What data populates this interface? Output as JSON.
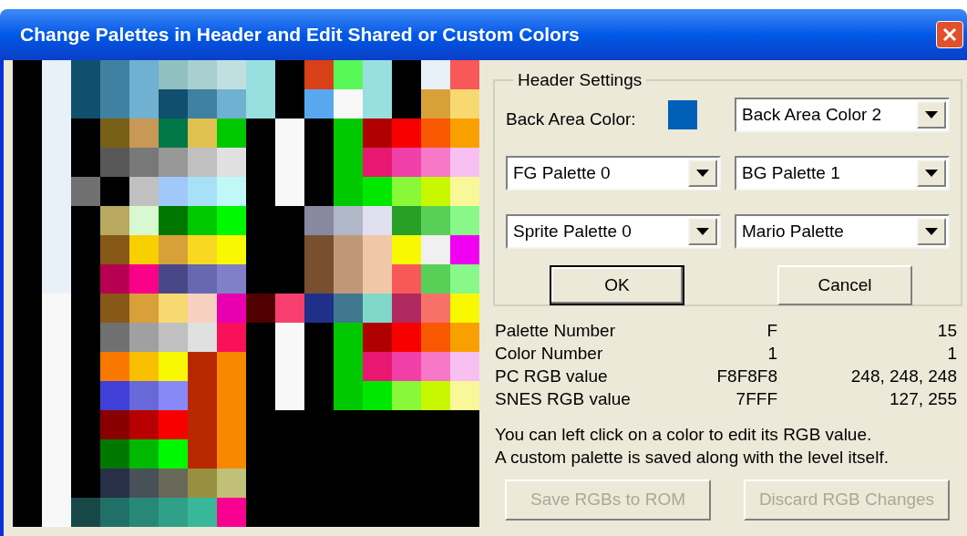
{
  "window": {
    "title": "Change Palettes in Header and Edit Shared or Custom Colors"
  },
  "palette": {
    "rows": [
      [
        null,
        {
          "color": "#e8f0f8"
        },
        {
          "color": "#10506e"
        },
        {
          "color": "#4080a0"
        },
        {
          "color": "#70b0d0"
        },
        {
          "color": "#90c0c0"
        },
        {
          "color": "#a8d0d0"
        },
        {
          "color": "#c0e0e0"
        },
        {
          "color": "#98e0e0"
        },
        null,
        {
          "color": "#d84018"
        },
        {
          "color": "#58f858"
        },
        {
          "color": "#98e0e0"
        },
        null,
        {
          "color": "#e8f0f8"
        },
        {
          "color": "#f85858"
        }
      ],
      [
        null,
        {
          "color": "#e8f0f8"
        },
        {
          "color": "#10506e"
        },
        {
          "color": "#4080a0"
        },
        {
          "color": "#70b0d0"
        },
        {
          "color": "#10506e"
        },
        {
          "color": "#4080a0"
        },
        {
          "color": "#70b0d0"
        },
        {
          "color": "#98e0e0"
        },
        null,
        {
          "color": "#58a8f0"
        },
        {
          "color": "#f8f8f8"
        },
        {
          "color": "#98e0e0"
        },
        null,
        {
          "color": "#d8a038"
        },
        {
          "color": "#f8d870"
        }
      ],
      [
        null,
        {
          "color": "#e8f0f8"
        },
        null,
        {
          "color": "#786018"
        },
        {
          "color": "#c89858"
        },
        {
          "color": "#007848"
        },
        {
          "color": "#e0c050"
        },
        {
          "color": "#00c800"
        },
        null,
        {
          "color": "#f8f8f8"
        },
        null,
        {
          "color": "#00c800"
        },
        {
          "color": "#b00000"
        },
        {
          "color": "#f80000"
        },
        {
          "color": "#f85800"
        },
        {
          "color": "#f8a000"
        }
      ],
      [
        null,
        {
          "color": "#e8f0f8"
        },
        null,
        {
          "color": "#585858"
        },
        {
          "color": "#787878"
        },
        {
          "color": "#989898"
        },
        {
          "color": "#c0c0c0"
        },
        {
          "color": "#e0e0e0"
        },
        null,
        {
          "color": "#f8f8f8"
        },
        null,
        {
          "color": "#00c800"
        },
        {
          "color": "#e81870"
        },
        {
          "color": "#f040a8"
        },
        {
          "color": "#f878c8"
        },
        {
          "color": "#f8c0f0"
        }
      ],
      [
        null,
        {
          "color": "#e8f0f8"
        },
        {
          "color": "#707070"
        },
        null,
        {
          "color": "#c0c0c0"
        },
        {
          "color": "#a0c8f8"
        },
        {
          "color": "#a8e0f8"
        },
        {
          "color": "#c0f8f8"
        },
        null,
        {
          "color": "#f8f8f8"
        },
        null,
        {
          "color": "#00c800"
        },
        {
          "color": "#00e800"
        },
        {
          "color": "#88f838"
        },
        {
          "color": "#c8f800"
        },
        {
          "color": "#f8f898"
        }
      ],
      [
        null,
        {
          "color": "#e8f0f8"
        },
        null,
        {
          "color": "#b8a860"
        },
        {
          "color": "#d8f8d0"
        },
        {
          "color": "#007800"
        },
        {
          "color": "#00c800"
        },
        {
          "color": "#00f800"
        },
        null,
        null,
        {
          "color": "#8888a0"
        },
        {
          "color": "#b0b8c8"
        },
        {
          "color": "#e0e0f0"
        },
        {
          "color": "#28a028"
        },
        {
          "color": "#58d058"
        },
        {
          "color": "#88f888"
        }
      ],
      [
        null,
        {
          "color": "#e8f0f8"
        },
        null,
        {
          "color": "#885818"
        },
        {
          "color": "#f8d000"
        },
        {
          "color": "#d8a038"
        },
        {
          "color": "#f8d820"
        },
        {
          "color": "#f8f800"
        },
        null,
        null,
        {
          "color": "#785030"
        },
        {
          "color": "#c09878"
        },
        {
          "color": "#f0c8a8"
        },
        {
          "color": "#f8f800"
        },
        {
          "color": "#f0f0f0"
        },
        {
          "color": "#f000f0"
        }
      ],
      [
        null,
        {
          "color": "#e8f0f8"
        },
        null,
        {
          "color": "#b80050"
        },
        {
          "color": "#f80088"
        },
        {
          "color": "#484888"
        },
        {
          "color": "#6868b0"
        },
        {
          "color": "#8080c8"
        },
        null,
        null,
        {
          "color": "#785030"
        },
        {
          "color": "#c09878"
        },
        {
          "color": "#f0c8a8"
        },
        {
          "color": "#f85858"
        },
        {
          "color": "#58d058"
        },
        {
          "color": "#88f888"
        }
      ],
      [
        null,
        {
          "color": "#f8f8f8"
        },
        null,
        {
          "color": "#885818"
        },
        {
          "color": "#d8a038"
        },
        {
          "color": "#f8d870"
        },
        {
          "color": "#f8d0c0"
        },
        {
          "color": "#e800b0"
        },
        {
          "color": "#500000"
        },
        {
          "color": "#f84070"
        },
        {
          "color": "#203088"
        },
        {
          "color": "#407890"
        },
        {
          "color": "#80d8c8"
        },
        {
          "color": "#b02860"
        },
        {
          "color": "#f87068"
        },
        {
          "color": "#f8f800"
        }
      ],
      [
        null,
        {
          "color": "#f8f8f8"
        },
        null,
        {
          "color": "#707070"
        },
        {
          "color": "#a0a0a0"
        },
        {
          "color": "#c0c0c0"
        },
        {
          "color": "#e0e0e0"
        },
        {
          "color": "#f81058"
        },
        null,
        {
          "color": "#f8f8f8"
        },
        null,
        {
          "color": "#00c800"
        },
        {
          "color": "#b00000"
        },
        {
          "color": "#f80000"
        },
        {
          "color": "#f85800"
        },
        {
          "color": "#f8a000"
        }
      ],
      [
        null,
        {
          "color": "#f8f8f8"
        },
        null,
        {
          "color": "#f87800"
        },
        {
          "color": "#f8c000"
        },
        {
          "color": "#f8f800"
        },
        {
          "color": "#b82800"
        },
        {
          "color": "#f88800"
        },
        null,
        {
          "color": "#f8f8f8"
        },
        null,
        {
          "color": "#00c800"
        },
        {
          "color": "#e81870"
        },
        {
          "color": "#f040a8"
        },
        {
          "color": "#f878c8"
        },
        {
          "color": "#f8c0f0"
        }
      ],
      [
        null,
        {
          "color": "#f8f8f8"
        },
        null,
        {
          "color": "#4040d8"
        },
        {
          "color": "#6868d8"
        },
        {
          "color": "#8888f8"
        },
        {
          "color": "#b82800"
        },
        {
          "color": "#f88800"
        },
        null,
        {
          "color": "#f8f8f8"
        },
        null,
        {
          "color": "#00c800"
        },
        {
          "color": "#00e800"
        },
        {
          "color": "#88f838"
        },
        {
          "color": "#c8f800"
        },
        {
          "color": "#f8f898"
        }
      ],
      [
        null,
        {
          "color": "#f8f8f8"
        },
        null,
        {
          "color": "#880000"
        },
        {
          "color": "#b80000"
        },
        {
          "color": "#f80000"
        },
        {
          "color": "#b82800"
        },
        {
          "color": "#f88800"
        },
        null,
        null,
        null,
        null,
        null,
        null,
        null,
        null
      ],
      [
        null,
        {
          "color": "#f8f8f8"
        },
        null,
        {
          "color": "#007800"
        },
        {
          "color": "#00b800"
        },
        {
          "color": "#00f800"
        },
        {
          "color": "#b82800"
        },
        {
          "color": "#f88800"
        },
        null,
        null,
        null,
        null,
        null,
        null,
        null,
        null
      ],
      [
        null,
        {
          "color": "#f8f8f8"
        },
        null,
        {
          "color": "#283048"
        },
        {
          "color": "#485058"
        },
        {
          "color": "#686858"
        },
        {
          "color": "#989040"
        },
        {
          "color": "#c0c078"
        },
        null,
        null,
        null,
        null,
        null,
        null,
        null,
        null
      ],
      [
        null,
        {
          "color": "#f8f8f8"
        },
        {
          "color": "#184848"
        },
        {
          "color": "#207068"
        },
        {
          "color": "#288878"
        },
        {
          "color": "#30a088"
        },
        {
          "color": "#38b898"
        },
        {
          "color": "#f80090"
        },
        null,
        null,
        null,
        null,
        null,
        null,
        null,
        null
      ]
    ]
  },
  "header_settings": {
    "legend": "Header Settings",
    "back_area_label": "Back Area Color:",
    "back_area_swatch": {
      "color": "#0060b8"
    },
    "dropdowns": [
      {
        "value": "Back Area Color 2"
      },
      {
        "value": "FG Palette 0"
      },
      {
        "value": "BG Palette 1"
      },
      {
        "value": "Sprite Palette 0"
      },
      {
        "value": "Mario Palette"
      }
    ],
    "buttons": [
      {
        "label": "OK",
        "default": true
      },
      {
        "label": "Cancel",
        "default": false
      }
    ]
  },
  "info": [
    {
      "label": "Palette Number",
      "hex": "F",
      "decimal": "15"
    },
    {
      "label": "Color Number",
      "hex": "1",
      "decimal": "1"
    },
    {
      "label": "PC RGB value",
      "hex": "F8F8F8",
      "decimal": "248, 248, 248"
    },
    {
      "label": "SNES RGB value",
      "hex": "7FFF",
      "decimal": "127, 255"
    }
  ],
  "help_lines": [
    "You can left click on a color to edit its RGB value.",
    "A custom palette is saved along with the level itself."
  ],
  "bottom_buttons": [
    {
      "label": "Save RGBs to ROM",
      "disabled": true
    },
    {
      "label": "Discard RGB Changes",
      "disabled": true
    }
  ]
}
